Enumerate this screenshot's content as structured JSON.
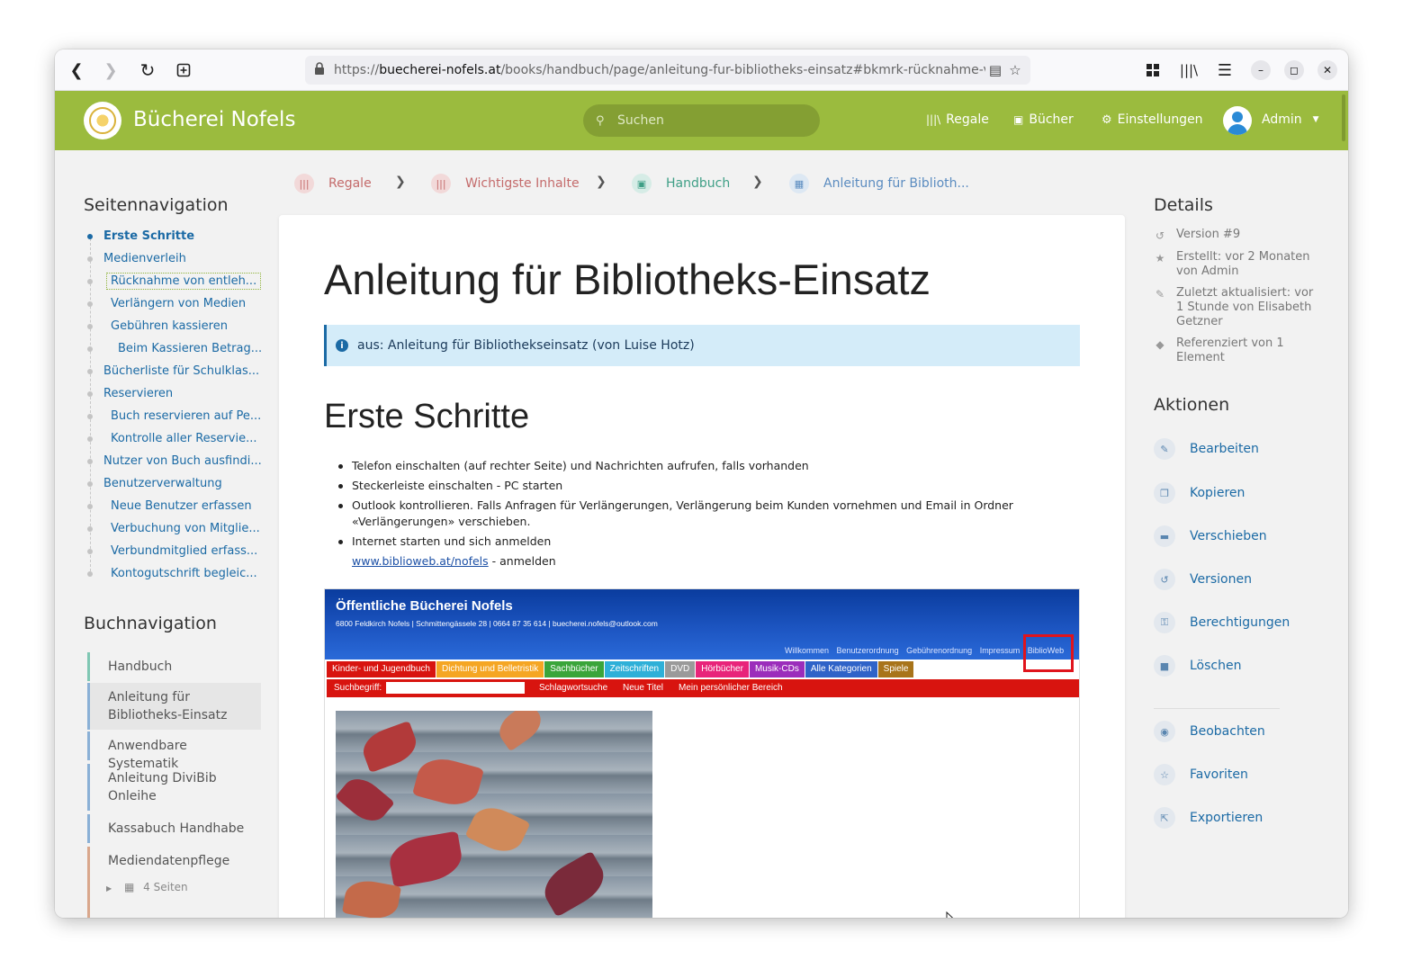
{
  "browser": {
    "url_prefix": "https://",
    "url_domain": "buecherei-nofels.at",
    "url_path": "/books/handbuch/page/anleitung-fur-bibliotheks-einsatz#bkmrk-rücknahme-von-er"
  },
  "header": {
    "site_name": "Bücherei Nofels",
    "search_placeholder": "Suchen",
    "nav": {
      "regale": "Regale",
      "buecher": "Bücher",
      "einstellungen": "Einstellungen"
    },
    "user": "Admin",
    "brand_color": "#9bbb3e"
  },
  "breadcrumb": [
    "Regale",
    "Wichtigste Inhalte",
    "Handbuch",
    "Anleitung für Biblioth..."
  ],
  "page_nav": {
    "heading": "Seitennavigation",
    "items": [
      "Erste Schritte",
      "Medienverleih",
      "Rücknahme von entleh...",
      "Verlängern von Medien",
      "Gebühren kassieren",
      "Beim Kassieren Betrag...",
      "Bücherliste für Schulklas...",
      "Reservieren",
      "Buch reservieren auf Pe...",
      "Kontrolle aller Reservie...",
      "Nutzer von Buch ausfindi...",
      "Benutzerverwaltung",
      "Neue Benutzer erfassen",
      "Verbuchung von Mitglie...",
      "Verbundmitglied erfass...",
      "Kontogutschrift begleic..."
    ]
  },
  "book_nav": {
    "heading": "Buchnavigation",
    "items": [
      {
        "line1": "Handbuch",
        "line2": ""
      },
      {
        "line1": "Anleitung für",
        "line2": "Bibliotheks-Einsatz"
      },
      {
        "line1": "Anwendbare Systematik",
        "line2": ""
      },
      {
        "line1": "Anleitung DiviBib",
        "line2": "Onleihe"
      },
      {
        "line1": "Kassabuch Handhabe",
        "line2": ""
      },
      {
        "line1": "Mediendatenpflege",
        "line2": ""
      }
    ],
    "subpages": "4 Seiten"
  },
  "content": {
    "title": "Anleitung für Bibliotheks-Einsatz",
    "callout": "aus: Anleitung für Bibliothekseinsatz (von Luise Hotz)",
    "h2": "Erste Schritte",
    "bullets": [
      "Telefon einschalten (auf rechter Seite) und Nachrichten aufrufen, falls vorhanden",
      "Steckerleiste einschalten - PC starten",
      "Outlook kontrollieren. Falls Anfragen für Verlängerungen, Verlängerung beim Kunden vornehmen und Email in Ordner «Verlängerungen» verschieben.",
      "Internet starten und sich anmelden"
    ],
    "link_text": "www.biblioweb.at/nofels",
    "link_suffix": " - anmelden"
  },
  "embedded": {
    "title": "Öffentliche Bücherei Nofels",
    "address": "6800 Feldkirch Nofels | Schmittengässele 28 | 0664 87 35 614 | buecherei.nofels@outlook.com",
    "links": [
      "Willkommen",
      "Benutzerordnung",
      "Gebührenordnung",
      "Impressum",
      "BiblioWeb"
    ],
    "categories": [
      {
        "label": "Kinder- und Jugendbuch",
        "color": "#d8140f"
      },
      {
        "label": "Dichtung und Belletristik",
        "color": "#f5a623"
      },
      {
        "label": "Sachbücher",
        "color": "#3aa53a"
      },
      {
        "label": "Zeitschriften",
        "color": "#2eb0d8"
      },
      {
        "label": "DVD",
        "color": "#9a9a9a"
      },
      {
        "label": "Hörbücher",
        "color": "#e8247a"
      },
      {
        "label": "Musik-CDs",
        "color": "#9b2dbb"
      },
      {
        "label": "Alle Kategorien",
        "color": "#2f63c8"
      },
      {
        "label": "Spiele",
        "color": "#a8741a"
      }
    ],
    "search_label": "Suchbegriff:",
    "bar_links": [
      "Schlagwortsuche",
      "Neue Titel",
      "Mein persönlicher Bereich"
    ]
  },
  "details": {
    "heading": "Details",
    "version": "Version #9",
    "created": "Erstellt: vor 2 Monaten von Admin",
    "updated": "Zuletzt aktualisiert: vor 1 Stunde von Elisabeth Getzner",
    "referenced": "Referenziert von 1 Element"
  },
  "actions": {
    "heading": "Aktionen",
    "items": [
      "Bearbeiten",
      "Kopieren",
      "Verschieben",
      "Versionen",
      "Berechtigungen",
      "Löschen"
    ],
    "items2": [
      "Beobachten",
      "Favoriten",
      "Exportieren"
    ]
  }
}
